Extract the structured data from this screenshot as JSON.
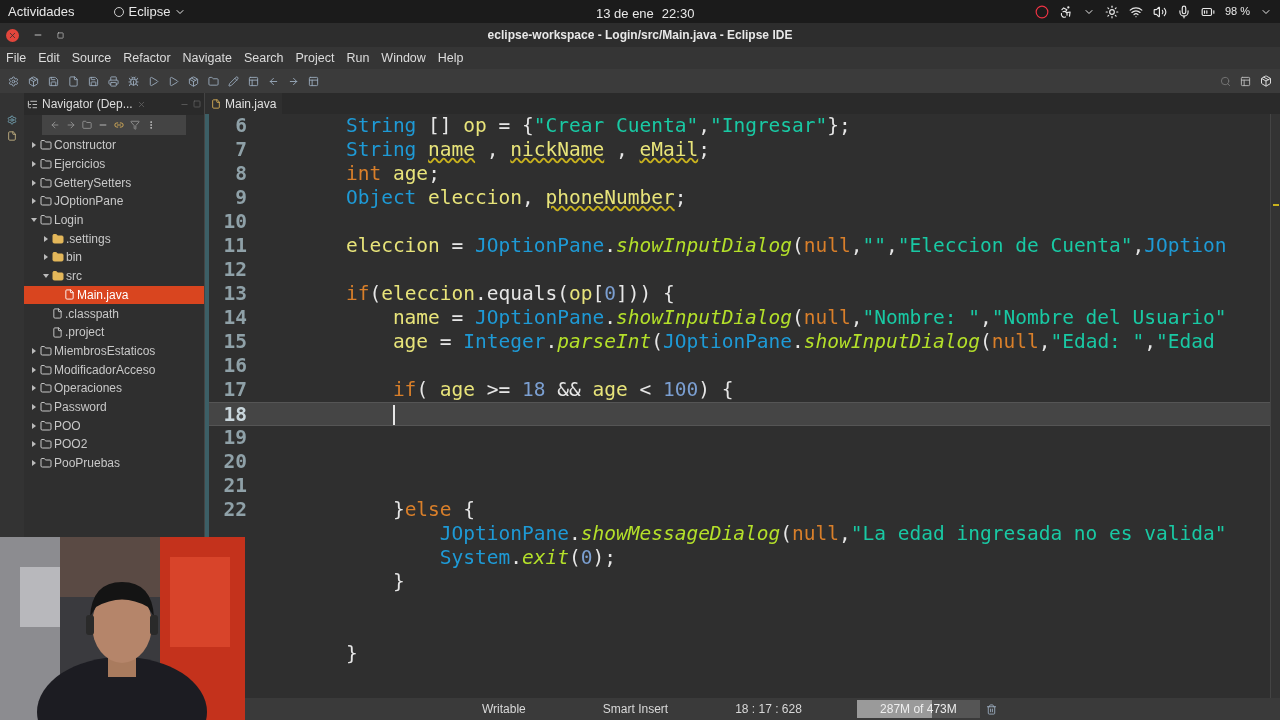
{
  "top_bar": {
    "activities": "Actividades",
    "app_menu": "Eclipse",
    "date": "13 de ene",
    "time": "22:30",
    "battery": "98 %"
  },
  "window": {
    "title": "eclipse-workspace - Login/src/Main.java - Eclipse IDE"
  },
  "menu": [
    "File",
    "Edit",
    "Source",
    "Refactor",
    "Navigate",
    "Search",
    "Project",
    "Run",
    "Window",
    "Help"
  ],
  "navigator": {
    "title": "Navigator (Dep...",
    "items": [
      {
        "kind": "project",
        "label": "Constructor",
        "expanded": false,
        "selected": false
      },
      {
        "kind": "project",
        "label": "Ejercicios",
        "expanded": false,
        "selected": false
      },
      {
        "kind": "project",
        "label": "GetterySetters",
        "expanded": false,
        "selected": false
      },
      {
        "kind": "project",
        "label": "JOptionPane",
        "expanded": false,
        "selected": false
      },
      {
        "kind": "project",
        "label": "Login",
        "expanded": true,
        "selected": false,
        "children": [
          {
            "kind": "folder",
            "label": ".settings",
            "expanded": false,
            "selected": false
          },
          {
            "kind": "folder",
            "label": "bin",
            "expanded": false,
            "selected": false
          },
          {
            "kind": "folder",
            "label": "src",
            "expanded": true,
            "selected": false,
            "children": [
              {
                "kind": "java",
                "label": "Main.java",
                "selected": true
              }
            ]
          },
          {
            "kind": "file",
            "label": ".classpath",
            "selected": false
          },
          {
            "kind": "file",
            "label": ".project",
            "selected": false
          }
        ]
      },
      {
        "kind": "project",
        "label": "MiembrosEstaticos",
        "expanded": false,
        "selected": false
      },
      {
        "kind": "project",
        "label": "ModificadorAcceso",
        "expanded": false,
        "selected": false
      },
      {
        "kind": "project",
        "label": "Operaciones",
        "expanded": false,
        "selected": false
      },
      {
        "kind": "project",
        "label": "Password",
        "expanded": false,
        "selected": false
      },
      {
        "kind": "project",
        "label": "POO",
        "expanded": false,
        "selected": false
      },
      {
        "kind": "project",
        "label": "POO2",
        "expanded": false,
        "selected": false
      },
      {
        "kind": "project",
        "label": "PooPruebas",
        "expanded": false,
        "selected": false
      }
    ]
  },
  "editor": {
    "tab": "Main.java",
    "lines": [
      {
        "number": "6",
        "current": false,
        "tokens": [
          {
            "kind": "type",
            "text": "        String"
          },
          {
            "kind": "plain",
            "text": " [] "
          },
          {
            "kind": "var",
            "text": "op"
          },
          {
            "kind": "plain",
            "text": " = {"
          },
          {
            "kind": "string",
            "text": "\"Crear Cuenta\""
          },
          {
            "kind": "plain",
            "text": ","
          },
          {
            "kind": "string",
            "text": "\"Ingresar\""
          },
          {
            "kind": "plain",
            "text": "};"
          }
        ]
      },
      {
        "number": "7",
        "current": false,
        "tokens": [
          {
            "kind": "type",
            "text": "        String "
          },
          {
            "kind": "warn",
            "text": "name"
          },
          {
            "kind": "plain",
            "text": " , "
          },
          {
            "kind": "warn",
            "text": "nickName"
          },
          {
            "kind": "plain",
            "text": " , "
          },
          {
            "kind": "warn",
            "text": "eMail"
          },
          {
            "kind": "plain",
            "text": ";"
          }
        ]
      },
      {
        "number": "8",
        "current": false,
        "tokens": [
          {
            "kind": "keyword",
            "text": "        int "
          },
          {
            "kind": "var",
            "text": "age"
          },
          {
            "kind": "plain",
            "text": ";"
          }
        ]
      },
      {
        "number": "9",
        "current": false,
        "tokens": [
          {
            "kind": "type",
            "text": "        Object "
          },
          {
            "kind": "var",
            "text": "eleccion"
          },
          {
            "kind": "plain",
            "text": ", "
          },
          {
            "kind": "warn",
            "text": "phoneNumber"
          },
          {
            "kind": "plain",
            "text": ";"
          }
        ]
      },
      {
        "number": "10",
        "current": false
      },
      {
        "number": "11",
        "current": false,
        "tokens": [
          {
            "kind": "var",
            "text": "        eleccion"
          },
          {
            "kind": "plain",
            "text": " = "
          },
          {
            "kind": "type",
            "text": "JOptionPane"
          },
          {
            "kind": "plain",
            "text": "."
          },
          {
            "kind": "method",
            "text": "showInputDialog"
          },
          {
            "kind": "plain",
            "text": "("
          },
          {
            "kind": "keyword",
            "text": "null"
          },
          {
            "kind": "plain",
            "text": ","
          },
          {
            "kind": "string",
            "text": "\"\""
          },
          {
            "kind": "plain",
            "text": ","
          },
          {
            "kind": "string",
            "text": "\"Eleccion de Cuenta\""
          },
          {
            "kind": "plain",
            "text": ","
          },
          {
            "kind": "type",
            "text": "JOption"
          }
        ]
      },
      {
        "number": "12",
        "current": false
      },
      {
        "number": "13",
        "current": false,
        "tokens": [
          {
            "kind": "keyword",
            "text": "        if"
          },
          {
            "kind": "plain",
            "text": "("
          },
          {
            "kind": "var",
            "text": "eleccion"
          },
          {
            "kind": "plain",
            "text": ".equals("
          },
          {
            "kind": "var",
            "text": "op"
          },
          {
            "kind": "plain",
            "text": "["
          },
          {
            "kind": "number",
            "text": "0"
          },
          {
            "kind": "plain",
            "text": "])) {"
          }
        ]
      },
      {
        "number": "14",
        "current": false,
        "tokens": [
          {
            "kind": "var",
            "text": "            name"
          },
          {
            "kind": "plain",
            "text": " = "
          },
          {
            "kind": "type",
            "text": "JOptionPane"
          },
          {
            "kind": "plain",
            "text": "."
          },
          {
            "kind": "method",
            "text": "showInputDialog"
          },
          {
            "kind": "plain",
            "text": "("
          },
          {
            "kind": "keyword",
            "text": "null"
          },
          {
            "kind": "plain",
            "text": ","
          },
          {
            "kind": "string",
            "text": "\"Nombre: \""
          },
          {
            "kind": "plain",
            "text": ","
          },
          {
            "kind": "string",
            "text": "\"Nombre del Usuario\""
          }
        ]
      },
      {
        "number": "15",
        "current": false,
        "tokens": [
          {
            "kind": "var",
            "text": "            age"
          },
          {
            "kind": "plain",
            "text": " = "
          },
          {
            "kind": "type",
            "text": "Integer"
          },
          {
            "kind": "plain",
            "text": "."
          },
          {
            "kind": "method",
            "text": "parseInt"
          },
          {
            "kind": "plain",
            "text": "("
          },
          {
            "kind": "type",
            "text": "JOptionPane"
          },
          {
            "kind": "plain",
            "text": "."
          },
          {
            "kind": "method",
            "text": "showInputDialog"
          },
          {
            "kind": "plain",
            "text": "("
          },
          {
            "kind": "keyword",
            "text": "null"
          },
          {
            "kind": "plain",
            "text": ","
          },
          {
            "kind": "string",
            "text": "\"Edad: \""
          },
          {
            "kind": "plain",
            "text": ","
          },
          {
            "kind": "string",
            "text": "\"Edad"
          }
        ]
      },
      {
        "number": "16",
        "current": false
      },
      {
        "number": "17",
        "current": false,
        "tokens": [
          {
            "kind": "keyword",
            "text": "            if"
          },
          {
            "kind": "plain",
            "text": "( "
          },
          {
            "kind": "var",
            "text": "age"
          },
          {
            "kind": "plain",
            "text": " >= "
          },
          {
            "kind": "number",
            "text": "18"
          },
          {
            "kind": "plain",
            "text": " && "
          },
          {
            "kind": "var",
            "text": "age"
          },
          {
            "kind": "plain",
            "text": " < "
          },
          {
            "kind": "number",
            "text": "100"
          },
          {
            "kind": "plain",
            "text": ") {"
          }
        ]
      },
      {
        "number": "18",
        "current": true
      },
      {
        "number": "19",
        "current": false
      },
      {
        "number": "20",
        "current": false
      },
      {
        "number": "21",
        "current": false
      },
      {
        "number": "22",
        "current": false,
        "tokens": [
          {
            "kind": "plain",
            "text": "            }"
          },
          {
            "kind": "keyword",
            "text": "else"
          },
          {
            "kind": "plain",
            "text": " {"
          }
        ]
      },
      {
        "current": false,
        "tokens": [
          {
            "kind": "type",
            "text": "                JOptionPane"
          },
          {
            "kind": "plain",
            "text": "."
          },
          {
            "kind": "method",
            "text": "showMessageDialog"
          },
          {
            "kind": "plain",
            "text": "("
          },
          {
            "kind": "keyword",
            "text": "null"
          },
          {
            "kind": "plain",
            "text": ","
          },
          {
            "kind": "string",
            "text": "\"La edad ingresada no es valida\""
          }
        ]
      },
      {
        "current": false,
        "tokens": [
          {
            "kind": "type",
            "text": "                System"
          },
          {
            "kind": "plain",
            "text": "."
          },
          {
            "kind": "method",
            "text": "exit"
          },
          {
            "kind": "plain",
            "text": "("
          },
          {
            "kind": "number",
            "text": "0"
          },
          {
            "kind": "plain",
            "text": ");"
          }
        ]
      },
      {
        "current": false,
        "tokens": [
          {
            "kind": "plain",
            "text": "            }"
          }
        ]
      },
      {
        "current": false
      },
      {
        "current": false
      },
      {
        "current": false,
        "tokens": [
          {
            "kind": "plain",
            "text": "        }"
          }
        ]
      }
    ]
  },
  "status_bar": {
    "mode": "Writable",
    "insert": "Smart Insert",
    "position": "18 : 17 : 628",
    "memory": {
      "text": "287M of 473M",
      "level": 0.61
    }
  },
  "webcam": {
    "kind": "picture"
  }
}
